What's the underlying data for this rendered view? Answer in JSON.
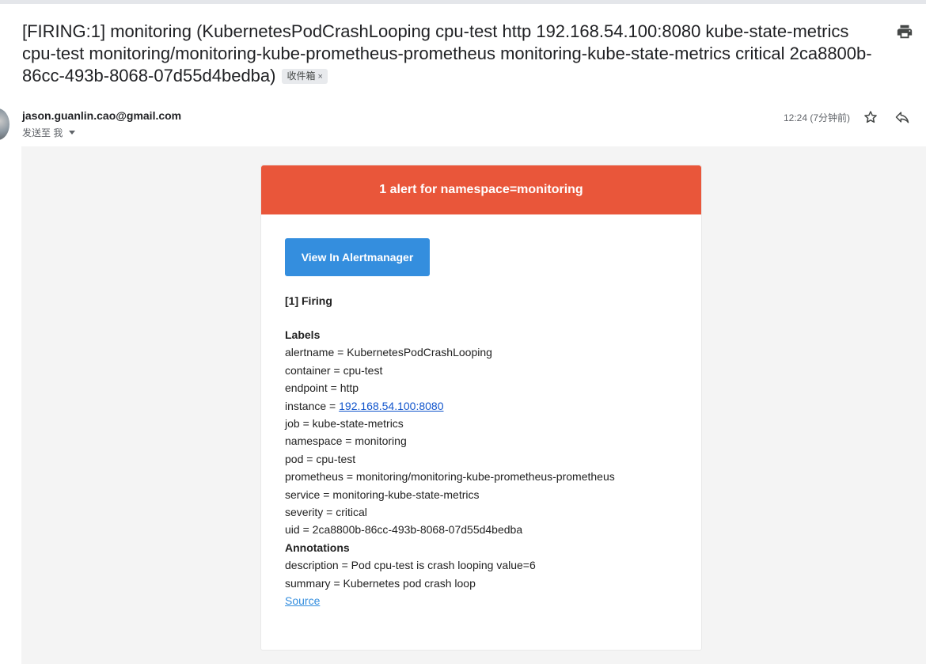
{
  "subject": {
    "title": "[FIRING:1] monitoring (KubernetesPodCrashLooping cpu-test http 192.168.54.100:8080 kube-state-metrics cpu-test monitoring/monitoring-kube-prometheus-prometheus monitoring-kube-state-metrics critical 2ca8800b-86cc-493b-8068-07d55d4bedba)",
    "label": "收件箱",
    "label_close": "×"
  },
  "header": {
    "sender": "jason.guanlin.cao@gmail.com",
    "recipient": "发送至 我",
    "time": "12:24 (7分钟前)"
  },
  "icons": {
    "print": "print-icon",
    "star": "star-icon",
    "reply": "reply-icon",
    "dropdown": "caret-down-icon"
  },
  "email": {
    "banner": "1 alert for namespace=monitoring",
    "button": "View In Alertmanager",
    "status": "[1] Firing",
    "labels_heading": "Labels",
    "labels": [
      {
        "key": "alertname",
        "value": "KubernetesPodCrashLooping"
      },
      {
        "key": "container",
        "value": "cpu-test"
      },
      {
        "key": "endpoint",
        "value": "http"
      },
      {
        "key": "instance",
        "value": "192.168.54.100:8080"
      },
      {
        "key": "job",
        "value": "kube-state-metrics"
      },
      {
        "key": "namespace",
        "value": "monitoring"
      },
      {
        "key": "pod",
        "value": "cpu-test"
      },
      {
        "key": "prometheus",
        "value": "monitoring/monitoring-kube-prometheus-prometheus"
      },
      {
        "key": "service",
        "value": "monitoring-kube-state-metrics"
      },
      {
        "key": "severity",
        "value": "critical"
      },
      {
        "key": "uid",
        "value": "2ca8800b-86cc-493b-8068-07d55d4bedba"
      }
    ],
    "annotations_heading": "Annotations",
    "annotations": [
      {
        "key": "description",
        "value": "Pod cpu-test is crash looping value=6"
      },
      {
        "key": "summary",
        "value": "Kubernetes pod crash loop"
      }
    ],
    "source_link": "Source"
  },
  "colors": {
    "banner": "#e9563a",
    "button": "#348ede",
    "link": "#1155cc",
    "body_bg": "#f4f4f4"
  }
}
